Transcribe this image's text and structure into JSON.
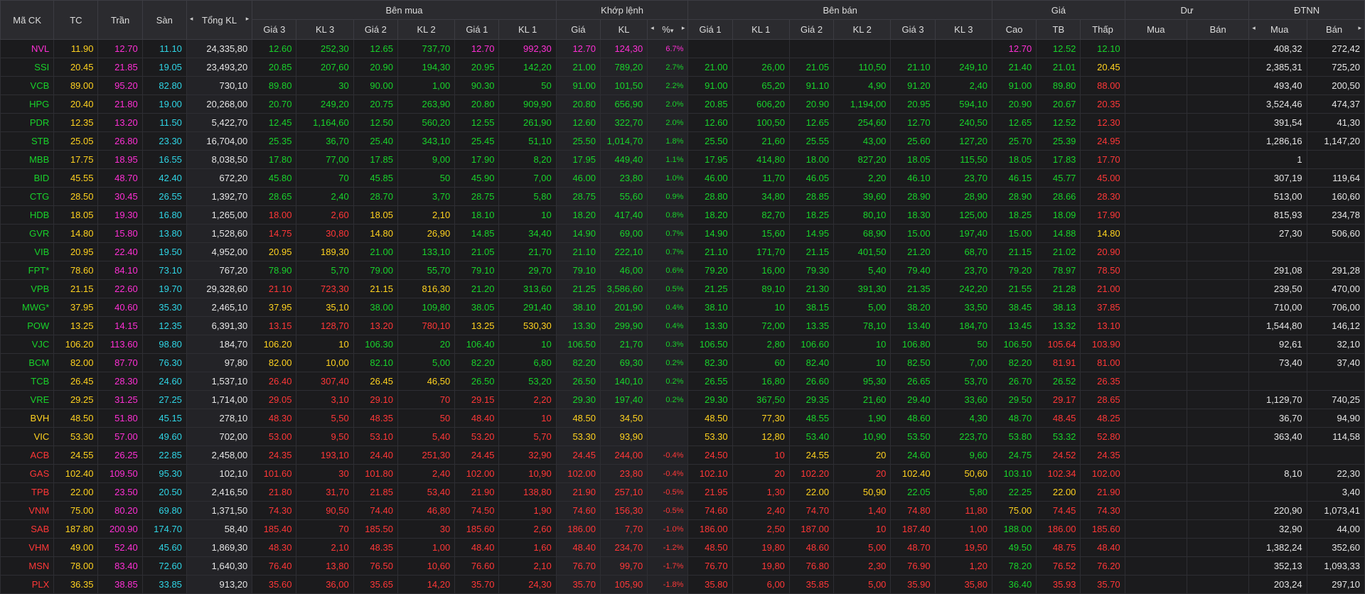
{
  "colors": {
    "up": "#18d32a",
    "down": "#ff3737",
    "ref": "#ffd21f",
    "ceil": "#ff2fd5",
    "floor": "#2fd6e6",
    "header_bg": "#2b2b2f",
    "bg": "#1b1b1d"
  },
  "header": {
    "symbol": "Mã CK",
    "ref": "TC",
    "ceil": "Trần",
    "floor": "Sàn",
    "total": "Tổng KL",
    "buy_group": "Bên mua",
    "match_group": "Khớp lệnh",
    "sell_group": "Bên bán",
    "price_group": "Giá",
    "remain_group": "Dư",
    "foreign_group": "ĐTNN",
    "buy_cols": [
      "Giá 3",
      "KL 3",
      "Giá 2",
      "KL 2",
      "Giá 1",
      "KL 1"
    ],
    "match_cols": [
      "Giá",
      "KL",
      "%"
    ],
    "sell_cols": [
      "Giá 1",
      "KL 1",
      "Giá 2",
      "KL 2",
      "Giá 3",
      "KL 3"
    ],
    "price_cols": [
      "Cao",
      "TB",
      "Thấp"
    ],
    "remain_cols": [
      "Mua",
      "Bán"
    ],
    "foreign_cols": [
      "Mua",
      "Bán"
    ],
    "arrow_left": "◂",
    "arrow_right": "▸",
    "sort_down": "▾"
  },
  "rows": [
    {
      "s": "NVL",
      "tc": "11.90",
      "tran": "12.70",
      "san": "11.10",
      "tkl": "24,335,80",
      "bp3": "12.60",
      "bv3": "252,30",
      "bp2": "12.65",
      "bv2": "737,70",
      "bp1": "12.70",
      "bv1": "992,30",
      "mp": "12.70",
      "mv": "124,30",
      "pct": "6.7%",
      "sp1": "",
      "sv1": "",
      "sp2": "",
      "sv2": "",
      "sp3": "",
      "sv3": "",
      "hi": "12.70",
      "avg": "12.52",
      "lo": "12.10",
      "dm": "",
      "db": "",
      "fb": "408,32",
      "fs": "272,42"
    },
    {
      "s": "SSI",
      "tc": "20.45",
      "tran": "21.85",
      "san": "19.05",
      "tkl": "23,493,20",
      "bp3": "20.85",
      "bv3": "207,60",
      "bp2": "20.90",
      "bv2": "194,30",
      "bp1": "20.95",
      "bv1": "142,20",
      "mp": "21.00",
      "mv": "789,20",
      "pct": "2.7%",
      "sp1": "21.00",
      "sv1": "26,00",
      "sp2": "21.05",
      "sv2": "110,50",
      "sp3": "21.10",
      "sv3": "249,10",
      "hi": "21.40",
      "avg": "21.01",
      "lo": "20.45",
      "dm": "",
      "db": "",
      "fb": "2,385,31",
      "fs": "725,20"
    },
    {
      "s": "VCB",
      "tc": "89.00",
      "tran": "95.20",
      "san": "82.80",
      "tkl": "730,10",
      "bp3": "89.80",
      "bv3": "30",
      "bp2": "90.00",
      "bv2": "1,00",
      "bp1": "90.30",
      "bv1": "50",
      "mp": "91.00",
      "mv": "101,50",
      "pct": "2.2%",
      "sp1": "91.00",
      "sv1": "65,20",
      "sp2": "91.10",
      "sv2": "4,90",
      "sp3": "91.20",
      "sv3": "2,40",
      "hi": "91.00",
      "avg": "89.80",
      "lo": "88.00",
      "dm": "",
      "db": "",
      "fb": "493,40",
      "fs": "200,50"
    },
    {
      "s": "HPG",
      "tc": "20.40",
      "tran": "21.80",
      "san": "19.00",
      "tkl": "20,268,00",
      "bp3": "20.70",
      "bv3": "249,20",
      "bp2": "20.75",
      "bv2": "263,90",
      "bp1": "20.80",
      "bv1": "909,90",
      "mp": "20.80",
      "mv": "656,90",
      "pct": "2.0%",
      "sp1": "20.85",
      "sv1": "606,20",
      "sp2": "20.90",
      "sv2": "1,194,00",
      "sp3": "20.95",
      "sv3": "594,10",
      "hi": "20.90",
      "avg": "20.67",
      "lo": "20.35",
      "dm": "",
      "db": "",
      "fb": "3,524,46",
      "fs": "474,37"
    },
    {
      "s": "PDR",
      "tc": "12.35",
      "tran": "13.20",
      "san": "11.50",
      "tkl": "5,422,70",
      "bp3": "12.45",
      "bv3": "1,164,60",
      "bp2": "12.50",
      "bv2": "560,20",
      "bp1": "12.55",
      "bv1": "261,90",
      "mp": "12.60",
      "mv": "322,70",
      "pct": "2.0%",
      "sp1": "12.60",
      "sv1": "100,50",
      "sp2": "12.65",
      "sv2": "254,60",
      "sp3": "12.70",
      "sv3": "240,50",
      "hi": "12.65",
      "avg": "12.52",
      "lo": "12.30",
      "dm": "",
      "db": "",
      "fb": "391,54",
      "fs": "41,30"
    },
    {
      "s": "STB",
      "tc": "25.05",
      "tran": "26.80",
      "san": "23.30",
      "tkl": "16,704,00",
      "bp3": "25.35",
      "bv3": "36,70",
      "bp2": "25.40",
      "bv2": "343,10",
      "bp1": "25.45",
      "bv1": "51,10",
      "mp": "25.50",
      "mv": "1,014,70",
      "pct": "1.8%",
      "sp1": "25.50",
      "sv1": "21,60",
      "sp2": "25.55",
      "sv2": "43,00",
      "sp3": "25.60",
      "sv3": "127,20",
      "hi": "25.70",
      "avg": "25.39",
      "lo": "24.95",
      "dm": "",
      "db": "",
      "fb": "1,286,16",
      "fs": "1,147,20"
    },
    {
      "s": "MBB",
      "tc": "17.75",
      "tran": "18.95",
      "san": "16.55",
      "tkl": "8,038,50",
      "bp3": "17.80",
      "bv3": "77,00",
      "bp2": "17.85",
      "bv2": "9,00",
      "bp1": "17.90",
      "bv1": "8,20",
      "mp": "17.95",
      "mv": "449,40",
      "pct": "1.1%",
      "sp1": "17.95",
      "sv1": "414,80",
      "sp2": "18.00",
      "sv2": "827,20",
      "sp3": "18.05",
      "sv3": "115,50",
      "hi": "18.05",
      "avg": "17.83",
      "lo": "17.70",
      "dm": "",
      "db": "",
      "fb": "1",
      "fs": ""
    },
    {
      "s": "BID",
      "tc": "45.55",
      "tran": "48.70",
      "san": "42.40",
      "tkl": "672,20",
      "bp3": "45.80",
      "bv3": "70",
      "bp2": "45.85",
      "bv2": "50",
      "bp1": "45.90",
      "bv1": "7,00",
      "mp": "46.00",
      "mv": "23,80",
      "pct": "1.0%",
      "sp1": "46.00",
      "sv1": "11,70",
      "sp2": "46.05",
      "sv2": "2,20",
      "sp3": "46.10",
      "sv3": "23,70",
      "hi": "46.15",
      "avg": "45.77",
      "lo": "45.00",
      "dm": "",
      "db": "",
      "fb": "307,19",
      "fs": "119,64"
    },
    {
      "s": "CTG",
      "tc": "28.50",
      "tran": "30.45",
      "san": "26.55",
      "tkl": "1,392,70",
      "bp3": "28.65",
      "bv3": "2,40",
      "bp2": "28.70",
      "bv2": "3,70",
      "bp1": "28.75",
      "bv1": "5,80",
      "mp": "28.75",
      "mv": "55,60",
      "pct": "0.9%",
      "sp1": "28.80",
      "sv1": "34,80",
      "sp2": "28.85",
      "sv2": "39,60",
      "sp3": "28.90",
      "sv3": "28,90",
      "hi": "28.90",
      "avg": "28.66",
      "lo": "28.30",
      "dm": "",
      "db": "",
      "fb": "513,00",
      "fs": "160,60"
    },
    {
      "s": "HDB",
      "tc": "18.05",
      "tran": "19.30",
      "san": "16.80",
      "tkl": "1,265,00",
      "bp3": "18.00",
      "bv3": "2,60",
      "bp2": "18.05",
      "bv2": "2,10",
      "bp1": "18.10",
      "bv1": "10",
      "mp": "18.20",
      "mv": "417,40",
      "pct": "0.8%",
      "sp1": "18.20",
      "sv1": "82,70",
      "sp2": "18.25",
      "sv2": "80,10",
      "sp3": "18.30",
      "sv3": "125,00",
      "hi": "18.25",
      "avg": "18.09",
      "lo": "17.90",
      "dm": "",
      "db": "",
      "fb": "815,93",
      "fs": "234,78"
    },
    {
      "s": "GVR",
      "tc": "14.80",
      "tran": "15.80",
      "san": "13.80",
      "tkl": "1,528,60",
      "bp3": "14.75",
      "bv3": "30,80",
      "bp2": "14.80",
      "bv2": "26,90",
      "bp1": "14.85",
      "bv1": "34,40",
      "mp": "14.90",
      "mv": "69,00",
      "pct": "0.7%",
      "sp1": "14.90",
      "sv1": "15,60",
      "sp2": "14.95",
      "sv2": "68,90",
      "sp3": "15.00",
      "sv3": "197,40",
      "hi": "15.00",
      "avg": "14.88",
      "lo": "14.80",
      "dm": "",
      "db": "",
      "fb": "27,30",
      "fs": "506,60"
    },
    {
      "s": "VIB",
      "tc": "20.95",
      "tran": "22.40",
      "san": "19.50",
      "tkl": "4,952,00",
      "bp3": "20.95",
      "bv3": "189,30",
      "bp2": "21.00",
      "bv2": "133,10",
      "bp1": "21.05",
      "bv1": "21,70",
      "mp": "21.10",
      "mv": "222,10",
      "pct": "0.7%",
      "sp1": "21.10",
      "sv1": "171,70",
      "sp2": "21.15",
      "sv2": "401,50",
      "sp3": "21.20",
      "sv3": "68,70",
      "hi": "21.15",
      "avg": "21.02",
      "lo": "20.90",
      "dm": "",
      "db": "",
      "fb": "",
      "fs": ""
    },
    {
      "s": "FPT*",
      "tc": "78.60",
      "tran": "84.10",
      "san": "73.10",
      "tkl": "767,20",
      "bp3": "78.90",
      "bv3": "5,70",
      "bp2": "79.00",
      "bv2": "55,70",
      "bp1": "79.10",
      "bv1": "29,70",
      "mp": "79.10",
      "mv": "46,00",
      "pct": "0.6%",
      "sp1": "79.20",
      "sv1": "16,00",
      "sp2": "79.30",
      "sv2": "5,40",
      "sp3": "79.40",
      "sv3": "23,70",
      "hi": "79.20",
      "avg": "78.97",
      "lo": "78.50",
      "dm": "",
      "db": "",
      "fb": "291,08",
      "fs": "291,28"
    },
    {
      "s": "VPB",
      "tc": "21.15",
      "tran": "22.60",
      "san": "19.70",
      "tkl": "29,328,60",
      "bp3": "21.10",
      "bv3": "723,30",
      "bp2": "21.15",
      "bv2": "816,30",
      "bp1": "21.20",
      "bv1": "313,60",
      "mp": "21.25",
      "mv": "3,586,60",
      "pct": "0.5%",
      "sp1": "21.25",
      "sv1": "89,10",
      "sp2": "21.30",
      "sv2": "391,30",
      "sp3": "21.35",
      "sv3": "242,20",
      "hi": "21.55",
      "avg": "21.28",
      "lo": "21.00",
      "dm": "",
      "db": "",
      "fb": "239,50",
      "fs": "470,00"
    },
    {
      "s": "MWG*",
      "tc": "37.95",
      "tran": "40.60",
      "san": "35.30",
      "tkl": "2,465,10",
      "bp3": "37.95",
      "bv3": "35,10",
      "bp2": "38.00",
      "bv2": "109,80",
      "bp1": "38.05",
      "bv1": "291,40",
      "mp": "38.10",
      "mv": "201,90",
      "pct": "0.4%",
      "sp1": "38.10",
      "sv1": "10",
      "sp2": "38.15",
      "sv2": "5,00",
      "sp3": "38.20",
      "sv3": "33,50",
      "hi": "38.45",
      "avg": "38.13",
      "lo": "37.85",
      "dm": "",
      "db": "",
      "fb": "710,00",
      "fs": "706,00"
    },
    {
      "s": "POW",
      "tc": "13.25",
      "tran": "14.15",
      "san": "12.35",
      "tkl": "6,391,30",
      "bp3": "13.15",
      "bv3": "128,70",
      "bp2": "13.20",
      "bv2": "780,10",
      "bp1": "13.25",
      "bv1": "530,30",
      "mp": "13.30",
      "mv": "299,90",
      "pct": "0.4%",
      "sp1": "13.30",
      "sv1": "72,00",
      "sp2": "13.35",
      "sv2": "78,10",
      "sp3": "13.40",
      "sv3": "184,70",
      "hi": "13.45",
      "avg": "13.32",
      "lo": "13.10",
      "dm": "",
      "db": "",
      "fb": "1,544,80",
      "fs": "146,12"
    },
    {
      "s": "VJC",
      "tc": "106.20",
      "tran": "113.60",
      "san": "98.80",
      "tkl": "184,70",
      "bp3": "106.20",
      "bv3": "10",
      "bp2": "106.30",
      "bv2": "20",
      "bp1": "106.40",
      "bv1": "10",
      "mp": "106.50",
      "mv": "21,70",
      "pct": "0.3%",
      "sp1": "106.50",
      "sv1": "2,80",
      "sp2": "106.60",
      "sv2": "10",
      "sp3": "106.80",
      "sv3": "50",
      "hi": "106.50",
      "avg": "105.64",
      "lo": "103.90",
      "dm": "",
      "db": "",
      "fb": "92,61",
      "fs": "32,10"
    },
    {
      "s": "BCM",
      "tc": "82.00",
      "tran": "87.70",
      "san": "76.30",
      "tkl": "97,80",
      "bp3": "82.00",
      "bv3": "10,00",
      "bp2": "82.10",
      "bv2": "5,00",
      "bp1": "82.20",
      "bv1": "6,80",
      "mp": "82.20",
      "mv": "69,30",
      "pct": "0.2%",
      "sp1": "82.30",
      "sv1": "60",
      "sp2": "82.40",
      "sv2": "10",
      "sp3": "82.50",
      "sv3": "7,00",
      "hi": "82.20",
      "avg": "81.91",
      "lo": "81.00",
      "dm": "",
      "db": "",
      "fb": "73,40",
      "fs": "37,40"
    },
    {
      "s": "TCB",
      "tc": "26.45",
      "tran": "28.30",
      "san": "24.60",
      "tkl": "1,537,10",
      "bp3": "26.40",
      "bv3": "307,40",
      "bp2": "26.45",
      "bv2": "46,50",
      "bp1": "26.50",
      "bv1": "53,20",
      "mp": "26.50",
      "mv": "140,10",
      "pct": "0.2%",
      "sp1": "26.55",
      "sv1": "16,80",
      "sp2": "26.60",
      "sv2": "95,30",
      "sp3": "26.65",
      "sv3": "53,70",
      "hi": "26.70",
      "avg": "26.52",
      "lo": "26.35",
      "dm": "",
      "db": "",
      "fb": "",
      "fs": ""
    },
    {
      "s": "VRE",
      "tc": "29.25",
      "tran": "31.25",
      "san": "27.25",
      "tkl": "1,714,00",
      "bp3": "29.05",
      "bv3": "3,10",
      "bp2": "29.10",
      "bv2": "70",
      "bp1": "29.15",
      "bv1": "2,20",
      "mp": "29.30",
      "mv": "197,40",
      "pct": "0.2%",
      "sp1": "29.30",
      "sv1": "367,50",
      "sp2": "29.35",
      "sv2": "21,60",
      "sp3": "29.40",
      "sv3": "33,60",
      "hi": "29.50",
      "avg": "29.17",
      "lo": "28.65",
      "dm": "",
      "db": "",
      "fb": "1,129,70",
      "fs": "740,25"
    },
    {
      "s": "BVH",
      "tc": "48.50",
      "tran": "51.80",
      "san": "45.15",
      "tkl": "278,10",
      "bp3": "48.30",
      "bv3": "5,50",
      "bp2": "48.35",
      "bv2": "50",
      "bp1": "48.40",
      "bv1": "10",
      "mp": "48.50",
      "mv": "34,50",
      "pct": "",
      "sp1": "48.50",
      "sv1": "77,30",
      "sp2": "48.55",
      "sv2": "1,90",
      "sp3": "48.60",
      "sv3": "4,30",
      "hi": "48.70",
      "avg": "48.45",
      "lo": "48.25",
      "dm": "",
      "db": "",
      "fb": "36,70",
      "fs": "94,90"
    },
    {
      "s": "VIC",
      "tc": "53.30",
      "tran": "57.00",
      "san": "49.60",
      "tkl": "702,00",
      "bp3": "53.00",
      "bv3": "9,50",
      "bp2": "53.10",
      "bv2": "5,40",
      "bp1": "53.20",
      "bv1": "5,70",
      "mp": "53.30",
      "mv": "93,90",
      "pct": "",
      "sp1": "53.30",
      "sv1": "12,80",
      "sp2": "53.40",
      "sv2": "10,90",
      "sp3": "53.50",
      "sv3": "223,70",
      "hi": "53.80",
      "avg": "53.32",
      "lo": "52.80",
      "dm": "",
      "db": "",
      "fb": "363,40",
      "fs": "114,58"
    },
    {
      "s": "ACB",
      "tc": "24.55",
      "tran": "26.25",
      "san": "22.85",
      "tkl": "2,458,00",
      "bp3": "24.35",
      "bv3": "193,10",
      "bp2": "24.40",
      "bv2": "251,30",
      "bp1": "24.45",
      "bv1": "32,90",
      "mp": "24.45",
      "mv": "244,00",
      "pct": "-0.4%",
      "sp1": "24.50",
      "sv1": "10",
      "sp2": "24.55",
      "sv2": "20",
      "sp3": "24.60",
      "sv3": "9,60",
      "hi": "24.75",
      "avg": "24.52",
      "lo": "24.35",
      "dm": "",
      "db": "",
      "fb": "",
      "fs": ""
    },
    {
      "s": "GAS",
      "tc": "102.40",
      "tran": "109.50",
      "san": "95.30",
      "tkl": "102,10",
      "bp3": "101.60",
      "bv3": "30",
      "bp2": "101.80",
      "bv2": "2,40",
      "bp1": "102.00",
      "bv1": "10,90",
      "mp": "102.00",
      "mv": "23,80",
      "pct": "-0.4%",
      "sp1": "102.10",
      "sv1": "20",
      "sp2": "102.20",
      "sv2": "20",
      "sp3": "102.40",
      "sv3": "50,60",
      "hi": "103.10",
      "avg": "102.34",
      "lo": "102.00",
      "dm": "",
      "db": "",
      "fb": "8,10",
      "fs": "22,30"
    },
    {
      "s": "TPB",
      "tc": "22.00",
      "tran": "23.50",
      "san": "20.50",
      "tkl": "2,416,50",
      "bp3": "21.80",
      "bv3": "31,70",
      "bp2": "21.85",
      "bv2": "53,40",
      "bp1": "21.90",
      "bv1": "138,80",
      "mp": "21.90",
      "mv": "257,10",
      "pct": "-0.5%",
      "sp1": "21.95",
      "sv1": "1,30",
      "sp2": "22.00",
      "sv2": "50,90",
      "sp3": "22.05",
      "sv3": "5,80",
      "hi": "22.25",
      "avg": "22.00",
      "lo": "21.90",
      "dm": "",
      "db": "",
      "fb": "",
      "fs": "3,40"
    },
    {
      "s": "VNM",
      "tc": "75.00",
      "tran": "80.20",
      "san": "69.80",
      "tkl": "1,371,50",
      "bp3": "74.30",
      "bv3": "90,50",
      "bp2": "74.40",
      "bv2": "46,80",
      "bp1": "74.50",
      "bv1": "1,90",
      "mp": "74.60",
      "mv": "156,30",
      "pct": "-0.5%",
      "sp1": "74.60",
      "sv1": "2,40",
      "sp2": "74.70",
      "sv2": "1,40",
      "sp3": "74.80",
      "sv3": "11,80",
      "hi": "75.00",
      "avg": "74.45",
      "lo": "74.30",
      "dm": "",
      "db": "",
      "fb": "220,90",
      "fs": "1,073,41"
    },
    {
      "s": "SAB",
      "tc": "187.80",
      "tran": "200.90",
      "san": "174.70",
      "tkl": "58,40",
      "bp3": "185.40",
      "bv3": "70",
      "bp2": "185.50",
      "bv2": "30",
      "bp1": "185.60",
      "bv1": "2,60",
      "mp": "186.00",
      "mv": "7,70",
      "pct": "-1.0%",
      "sp1": "186.00",
      "sv1": "2,50",
      "sp2": "187.00",
      "sv2": "10",
      "sp3": "187.40",
      "sv3": "1,00",
      "hi": "188.00",
      "avg": "186.00",
      "lo": "185.60",
      "dm": "",
      "db": "",
      "fb": "32,90",
      "fs": "44,00"
    },
    {
      "s": "VHM",
      "tc": "49.00",
      "tran": "52.40",
      "san": "45.60",
      "tkl": "1,869,30",
      "bp3": "48.30",
      "bv3": "2,10",
      "bp2": "48.35",
      "bv2": "1,00",
      "bp1": "48.40",
      "bv1": "1,60",
      "mp": "48.40",
      "mv": "234,70",
      "pct": "-1.2%",
      "sp1": "48.50",
      "sv1": "19,80",
      "sp2": "48.60",
      "sv2": "5,00",
      "sp3": "48.70",
      "sv3": "19,50",
      "hi": "49.50",
      "avg": "48.75",
      "lo": "48.40",
      "dm": "",
      "db": "",
      "fb": "1,382,24",
      "fs": "352,60"
    },
    {
      "s": "MSN",
      "tc": "78.00",
      "tran": "83.40",
      "san": "72.60",
      "tkl": "1,640,30",
      "bp3": "76.40",
      "bv3": "13,80",
      "bp2": "76.50",
      "bv2": "10,60",
      "bp1": "76.60",
      "bv1": "2,10",
      "mp": "76.70",
      "mv": "99,70",
      "pct": "-1.7%",
      "sp1": "76.70",
      "sv1": "19,80",
      "sp2": "76.80",
      "sv2": "2,30",
      "sp3": "76.90",
      "sv3": "1,20",
      "hi": "78.20",
      "avg": "76.52",
      "lo": "76.20",
      "dm": "",
      "db": "",
      "fb": "352,13",
      "fs": "1,093,33"
    },
    {
      "s": "PLX",
      "tc": "36.35",
      "tran": "38.85",
      "san": "33.85",
      "tkl": "913,20",
      "bp3": "35.60",
      "bv3": "36,00",
      "bp2": "35.65",
      "bv2": "14,20",
      "bp1": "35.70",
      "bv1": "24,30",
      "mp": "35.70",
      "mv": "105,90",
      "pct": "-1.8%",
      "sp1": "35.80",
      "sv1": "6,00",
      "sp2": "35.85",
      "sv2": "5,00",
      "sp3": "35.90",
      "sv3": "35,80",
      "hi": "36.40",
      "avg": "35.93",
      "lo": "35.70",
      "dm": "",
      "db": "",
      "fb": "203,24",
      "fs": "297,10"
    }
  ]
}
